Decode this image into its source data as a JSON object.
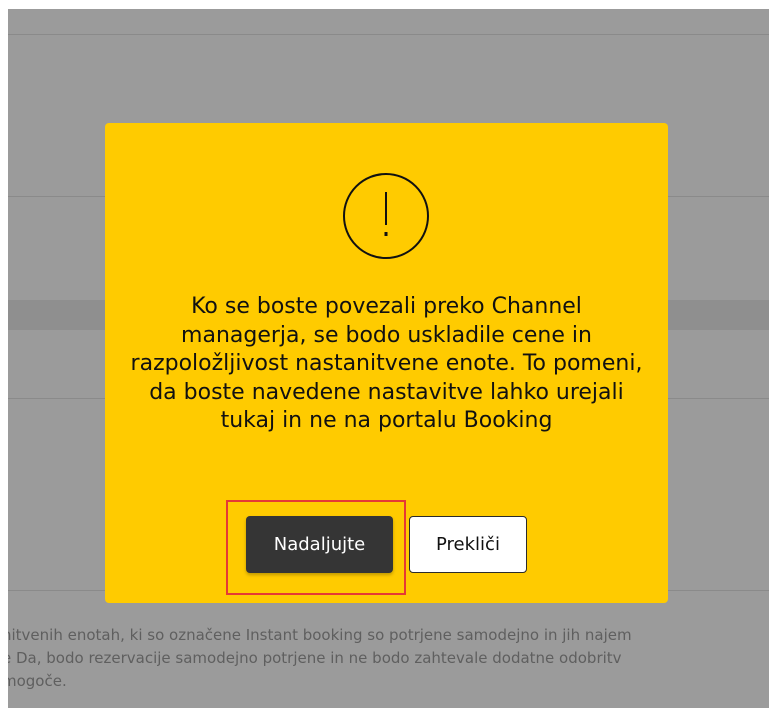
{
  "background": {
    "text_lines": [
      "nitvenih enotah, ki so označene Instant booking so potrjene samodejno in jih najem",
      "e Da, bodo rezervacije samodejno potrjene in ne bodo zahtevale dodatne odobritv",
      "mogoče."
    ]
  },
  "modal": {
    "icon": "exclamation-circle-icon",
    "message": "Ko se boste povezali preko Channel managerja, se bodo uskladile cene in razpoložljivost nastanitvene enote. To pomeni, da boste navedene nastavitve lahko urejali tukaj in ne na portalu Booking",
    "continue_label": "Nadaljujte",
    "cancel_label": "Prekliči"
  },
  "colors": {
    "modal_background": "#ffcb00",
    "primary_button": "#353535",
    "highlight_border": "#e53935"
  }
}
